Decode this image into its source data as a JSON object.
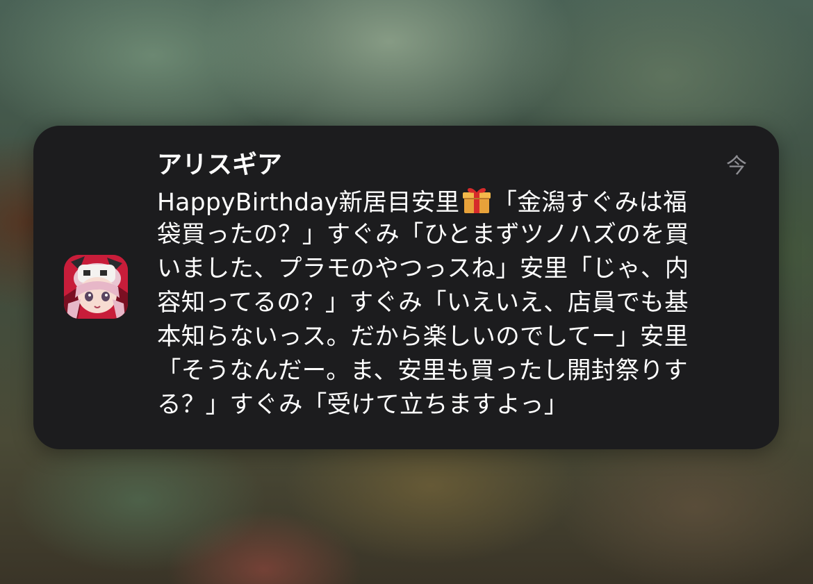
{
  "notification": {
    "app_icon": "alicegear-app-icon",
    "app_name": "アリスギア",
    "timestamp": "今",
    "message_lines": [
      {
        "before": "HappyBirthday新居目安里",
        "emoji": "gift-emoji-icon",
        "after": "「金潟すぐみは福"
      },
      {
        "text": "袋買ったの？」すぐみ「ひとまずツノハズのを買"
      },
      {
        "text": "いました、プラモのやつっスね」安里「じゃ、内"
      },
      {
        "text": "容知ってるの？」すぐみ「いえいえ、店員でも基"
      },
      {
        "text": "本知らないっス。だから楽しいのでしてー」安里"
      },
      {
        "text": "「そうなんだー。ま、安里も買ったし開封祭りす"
      },
      {
        "text": "る？」すぐみ「受けて立ちますよっ」"
      }
    ]
  },
  "colors": {
    "card_background": "#1c1c1e",
    "primary_text": "#ffffff",
    "secondary_text": "#8e8e93",
    "icon_background": "#d02340"
  }
}
